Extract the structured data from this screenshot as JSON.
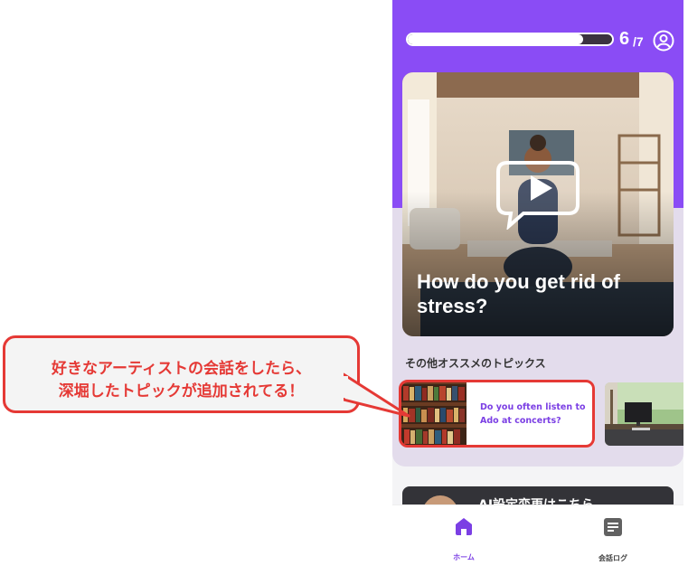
{
  "header": {
    "progress_current": "6",
    "progress_total": "/7",
    "progress_fraction": 0.86
  },
  "hero": {
    "title": "How do you get rid of stress?",
    "play_icon": "play-bubble-icon"
  },
  "topics": {
    "heading": "その他オススメのトピックス",
    "items": [
      {
        "label": "Do you often listen to Ado at concerts?"
      }
    ]
  },
  "banner": {
    "text": "AI設定変更はこちら"
  },
  "bottom_nav": {
    "items": [
      {
        "label": "ホーム",
        "icon": "home-icon"
      },
      {
        "label": "会話ログ",
        "icon": "log-icon"
      }
    ]
  },
  "annotation": {
    "line1": "好きなアーティストの会話をしたら、",
    "line2": "深堀したトピックが追加されてる！"
  },
  "colors": {
    "brand_purple": "#8a4cf5",
    "annotation_red": "#e53935"
  }
}
